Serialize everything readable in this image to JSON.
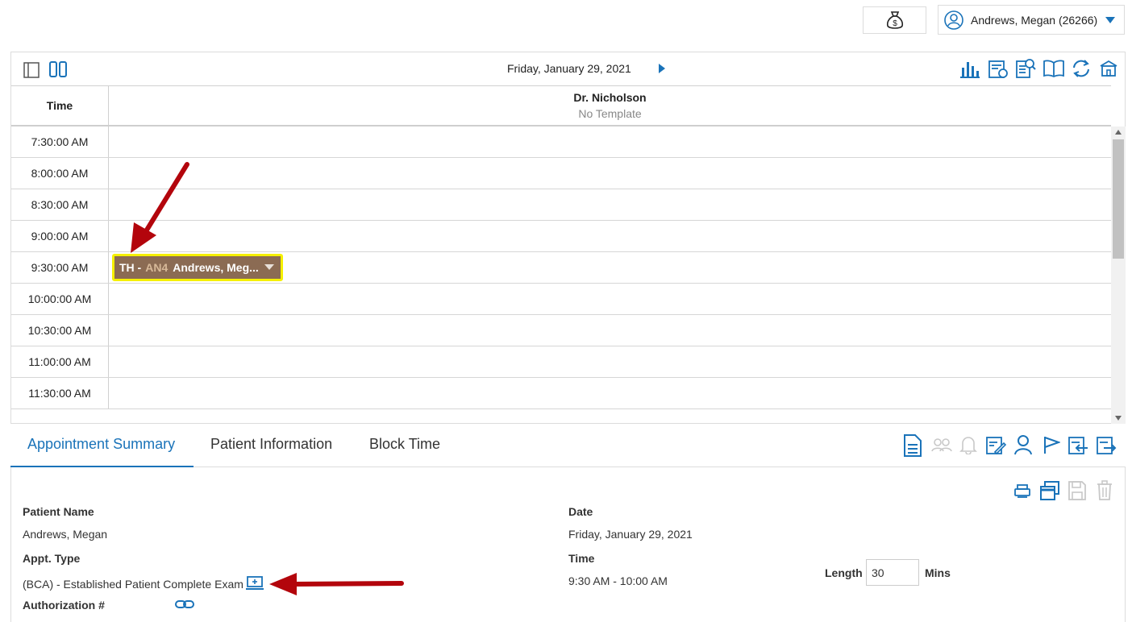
{
  "topbar": {
    "user_label": "Andrews, Megan (26266)"
  },
  "calendar": {
    "date": "Friday, January 29, 2021",
    "time_header": "Time",
    "doctor": "Dr. Nicholson",
    "template": "No Template",
    "rows": [
      "7:30:00 AM",
      "8:00:00 AM",
      "8:30:00 AM",
      "9:00:00 AM",
      "9:30:00 AM",
      "10:00:00 AM",
      "10:30:00 AM",
      "11:00:00 AM",
      "11:30:00 AM"
    ],
    "appointment": {
      "prefix": "TH -",
      "code": "AN4",
      "patient": "Andrews, Meg..."
    }
  },
  "tabs": [
    {
      "label": "Appointment Summary"
    },
    {
      "label": "Patient Information"
    },
    {
      "label": "Block Time"
    }
  ],
  "summary": {
    "patient_name_label": "Patient Name",
    "patient_name": "Andrews, Megan",
    "appt_type_label": "Appt. Type",
    "appt_type": "(BCA) - Established Patient Complete Exam",
    "authorization_label": "Authorization #",
    "date_label": "Date",
    "date": "Friday, January 29, 2021",
    "time_label": "Time",
    "time": "9:30 AM - 10:00 AM",
    "length_label": "Length",
    "length_value": "30",
    "length_unit": "Mins"
  },
  "colors": {
    "accent": "#1a73b9",
    "appointment_bg": "#8b6b53",
    "highlight": "#f5f000",
    "arrow": "#b3050c"
  }
}
